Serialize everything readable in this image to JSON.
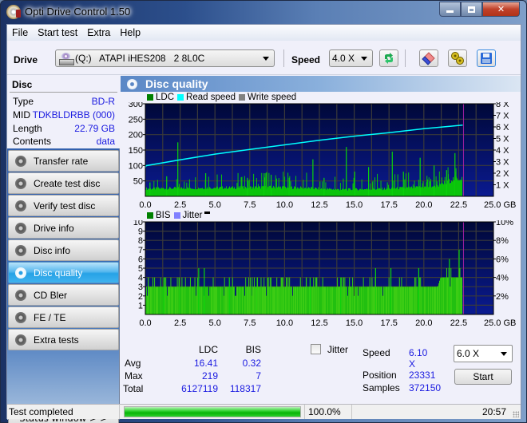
{
  "window": {
    "title": "Opti Drive Control 1.50",
    "controls": {
      "minimize": "—",
      "maximize": "□",
      "close": "✕"
    }
  },
  "menu": [
    "File",
    "Start test",
    "Extra",
    "Help"
  ],
  "toolbar": {
    "drive_label": "Drive",
    "drive_value": "(Q:)   ATAPI iHES208   2 8L0C",
    "speed_label": "Speed",
    "speed_value": "4.0 X",
    "buttons": [
      "refresh-icon",
      "eraser-icon",
      "settings-icon",
      "save-icon"
    ]
  },
  "disc": {
    "heading": "Disc",
    "rows": [
      {
        "label": "Type",
        "value": "BD-R"
      },
      {
        "label": "MID",
        "value": "TDKBLDRBB (000)"
      },
      {
        "label": "Length",
        "value": "22.79 GB"
      },
      {
        "label": "Contents",
        "value": "data"
      }
    ]
  },
  "nav": [
    {
      "label": "Transfer rate",
      "active": false
    },
    {
      "label": "Create test disc",
      "active": false
    },
    {
      "label": "Verify test disc",
      "active": false
    },
    {
      "label": "Drive info",
      "active": false
    },
    {
      "label": "Disc info",
      "active": false
    },
    {
      "label": "Disc quality",
      "active": true
    },
    {
      "label": "CD Bler",
      "active": false
    },
    {
      "label": "FE / TE",
      "active": false
    },
    {
      "label": "Extra tests",
      "active": false
    }
  ],
  "status_window_button": "Status window > >",
  "panel": {
    "title": "Disc quality"
  },
  "colors": {
    "ldc": "#008000",
    "read_speed": "#00ffff",
    "write_speed": "#808080",
    "bis": "#008000",
    "jitter": "#8080ff",
    "bar_fill": "#11cc11",
    "marker": "#a020a0"
  },
  "chart_data": [
    {
      "type": "bar",
      "title": "LDC",
      "legend": [
        "LDC",
        "Read speed",
        "Write speed"
      ],
      "legend_position": "top-left",
      "xlabel": "GB",
      "x_ticks": [
        "0.0",
        "2.5",
        "5.0",
        "7.5",
        "10.0",
        "12.5",
        "15.0",
        "17.5",
        "20.0",
        "22.5",
        "25.0 GB"
      ],
      "xlim": [
        0,
        25
      ],
      "y_ticks": [
        "50",
        "100",
        "150",
        "200",
        "250",
        "300"
      ],
      "ylim": [
        0,
        300
      ],
      "y2_ticks": [
        "1 X",
        "2 X",
        "3 X",
        "4 X",
        "5 X",
        "6 X",
        "7 X",
        "8 X"
      ],
      "y2lim": [
        0,
        8
      ],
      "grid": true,
      "data_end_gb": 22.79,
      "ldc_baseline": [
        [
          0,
          25
        ],
        [
          5,
          28
        ],
        [
          10,
          30
        ],
        [
          14,
          22
        ],
        [
          17,
          24
        ],
        [
          20,
          30
        ],
        [
          21.5,
          38
        ],
        [
          22,
          55
        ],
        [
          22.79,
          60
        ]
      ],
      "ldc_spikes": [
        [
          0.3,
          45
        ],
        [
          1.5,
          65
        ],
        [
          2.3,
          175
        ],
        [
          4.3,
          75
        ],
        [
          7.3,
          60
        ],
        [
          8.5,
          75
        ],
        [
          9.0,
          70
        ],
        [
          10.3,
          60
        ],
        [
          12.0,
          120
        ],
        [
          12.8,
          60
        ],
        [
          14.4,
          160
        ],
        [
          15.0,
          80
        ],
        [
          16.0,
          95
        ],
        [
          17.7,
          145
        ],
        [
          18.5,
          80
        ],
        [
          19.7,
          125
        ],
        [
          20.7,
          100
        ],
        [
          21.6,
          85
        ],
        [
          22.2,
          140
        ]
      ],
      "read_speed_x": [
        [
          0,
          2.5
        ],
        [
          0.05,
          2.65
        ],
        [
          2.5,
          3.15
        ],
        [
          5,
          3.65
        ],
        [
          7.5,
          4.05
        ],
        [
          10,
          4.45
        ],
        [
          12.5,
          4.85
        ],
        [
          15,
          5.2
        ],
        [
          17.5,
          5.5
        ],
        [
          20,
          5.85
        ],
        [
          22.79,
          6.15
        ]
      ]
    },
    {
      "type": "bar",
      "title": "BIS",
      "legend": [
        "BIS",
        "Jitter"
      ],
      "legend_position": "top-left",
      "xlabel": "GB",
      "x_ticks": [
        "0.0",
        "2.5",
        "5.0",
        "7.5",
        "10.0",
        "12.5",
        "15.0",
        "17.5",
        "20.0",
        "22.5",
        "25.0 GB"
      ],
      "xlim": [
        0,
        25
      ],
      "y_ticks": [
        "1",
        "2",
        "3",
        "4",
        "5",
        "6",
        "7",
        "8",
        "9",
        "10"
      ],
      "ylim": [
        0,
        10
      ],
      "y2_ticks": [
        "2%",
        "4%",
        "6%",
        "8%",
        "10%"
      ],
      "y2lim": [
        0,
        10
      ],
      "grid": true,
      "data_end_gb": 22.79,
      "bis_baseline": [
        [
          0,
          3
        ],
        [
          21,
          3
        ],
        [
          21.2,
          4
        ],
        [
          22.79,
          4
        ]
      ],
      "bis_spikes": [
        [
          3.8,
          5
        ],
        [
          4.2,
          5
        ],
        [
          1.3,
          4
        ],
        [
          2.4,
          4
        ],
        [
          6.0,
          4
        ],
        [
          8.0,
          4
        ],
        [
          11.8,
          4
        ],
        [
          14.0,
          4
        ],
        [
          16.5,
          5
        ],
        [
          17.6,
          5
        ],
        [
          19.6,
          5
        ],
        [
          21.8,
          6
        ],
        [
          22.5,
          7
        ]
      ]
    }
  ],
  "stats": {
    "col_ldc": "LDC",
    "col_bis": "BIS",
    "rows": [
      {
        "label": "Avg",
        "ldc": "16.41",
        "bis": "0.32"
      },
      {
        "label": "Max",
        "ldc": "219",
        "bis": "7"
      },
      {
        "label": "Total",
        "ldc": "6127119",
        "bis": "118317"
      }
    ],
    "jitter_label": "Jitter",
    "jitter_checked": false,
    "speed_label": "Speed",
    "speed_value": "6.10 X",
    "position_label": "Position",
    "position_value": "23331",
    "samples_label": "Samples",
    "samples_value": "372150",
    "speed_select": "6.0 X",
    "start_button": "Start"
  },
  "statusbar": {
    "text": "Test completed",
    "progress": 100.0,
    "progress_text": "100.0%",
    "time": "20:57"
  }
}
